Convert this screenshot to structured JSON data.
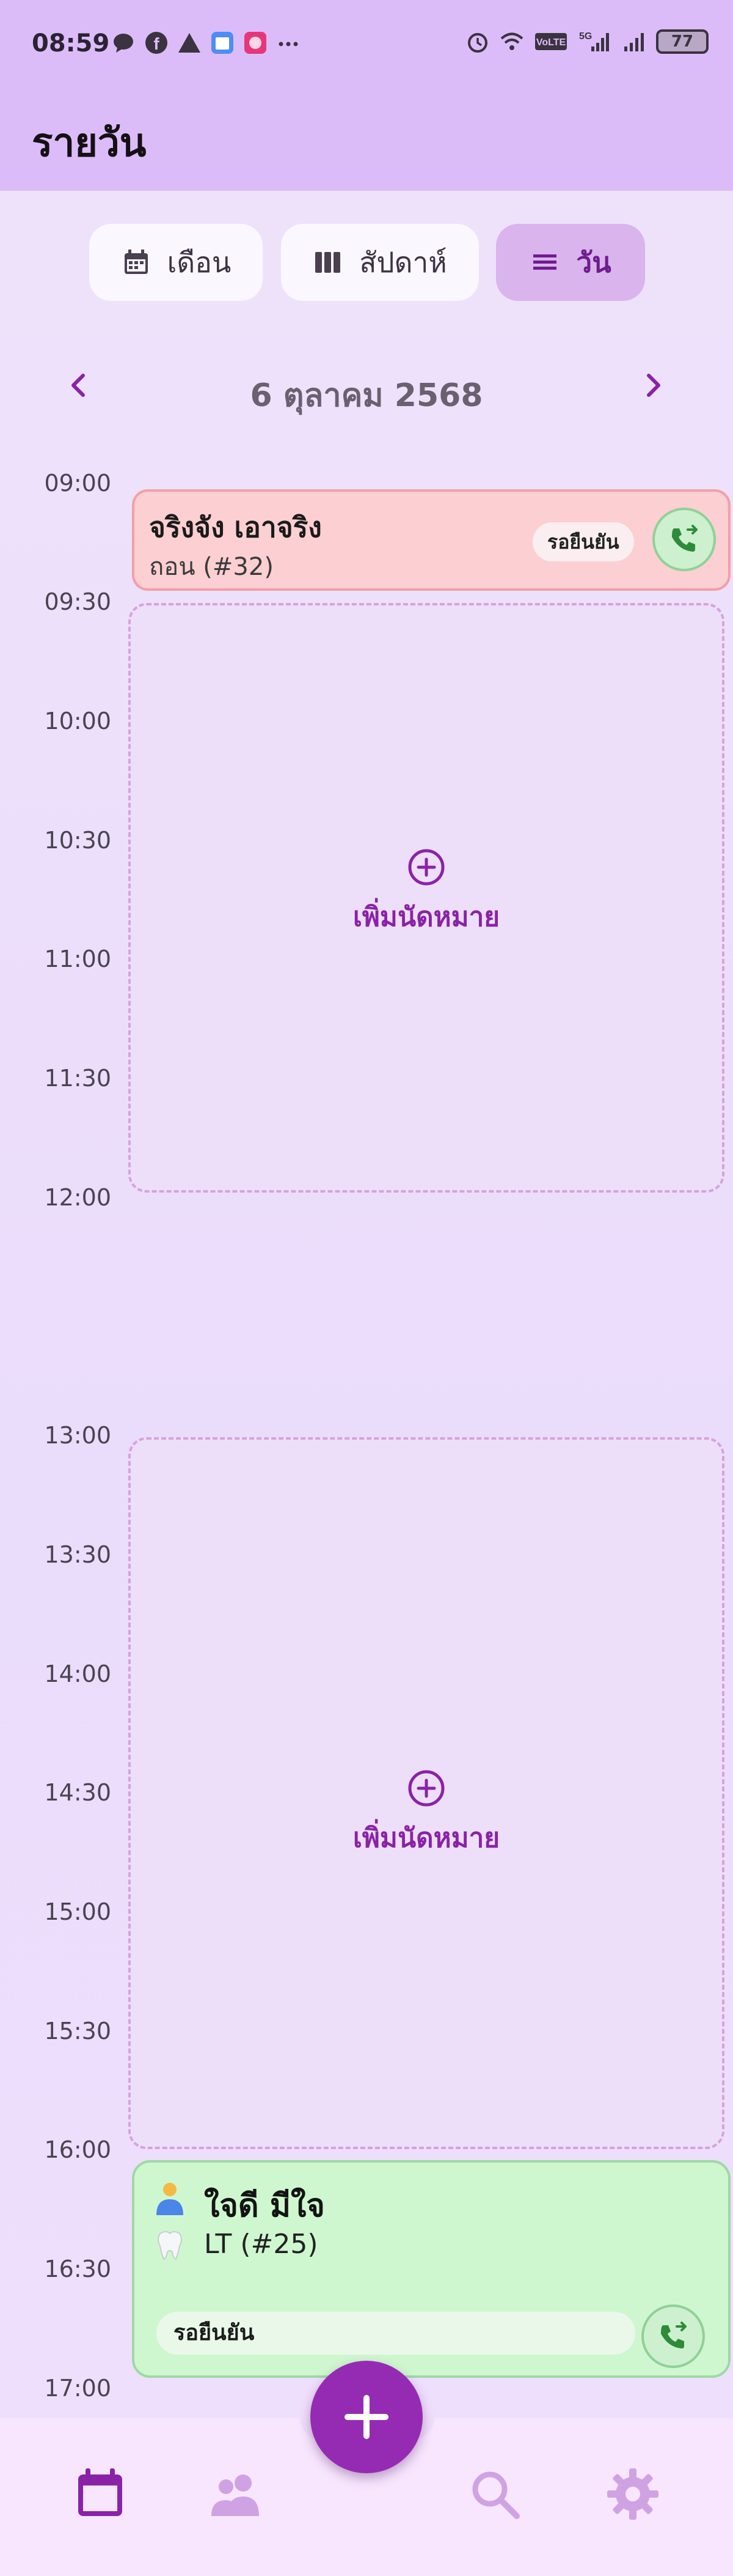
{
  "status_bar": {
    "time": "08:59",
    "battery": "77",
    "left_icons": [
      "chat-bubble-icon",
      "facebook-icon",
      "triangle-icon",
      "calendar-app-icon",
      "game-app-icon",
      "more-dots-icon"
    ],
    "right_icons": [
      "alarm-icon",
      "wifi-icon",
      "volte-icon",
      "5g-signal-icon",
      "signal-icon",
      "battery-icon"
    ]
  },
  "app_bar": {
    "title": "รายวัน"
  },
  "view_toggle": {
    "month": "เดือน",
    "week": "สัปดาห์",
    "day": "วัน",
    "selected": "day"
  },
  "date_nav": {
    "label": "6 ตุลาคม 2568"
  },
  "time_slots": [
    "09:00",
    "09:30",
    "10:00",
    "10:30",
    "11:00",
    "11:30",
    "12:00",
    "13:00",
    "13:30",
    "14:00",
    "14:30",
    "15:00",
    "15:30",
    "16:00",
    "16:30",
    "17:00"
  ],
  "appointments": [
    {
      "name": "จริงจัง เอาจริง",
      "procedure": "ถอน (#32)",
      "status": "รอยืนยัน",
      "color": "#fccfd2"
    },
    {
      "name": "ใจดี มีใจ",
      "procedure": "LT (#25)",
      "status": "รอยืนยัน",
      "color": "#cff7cf"
    }
  ],
  "empty_slots": [
    {
      "label": "เพิ่มนัดหมาย"
    },
    {
      "label": "เพิ่มนัดหมาย"
    }
  ],
  "bottom_nav": {
    "items": [
      "calendar-icon",
      "patients-icon",
      "search-icon",
      "settings-icon"
    ],
    "active": "calendar-icon"
  },
  "colors": {
    "accent": "#962bb3",
    "app_bar": "#dcbcf8"
  }
}
